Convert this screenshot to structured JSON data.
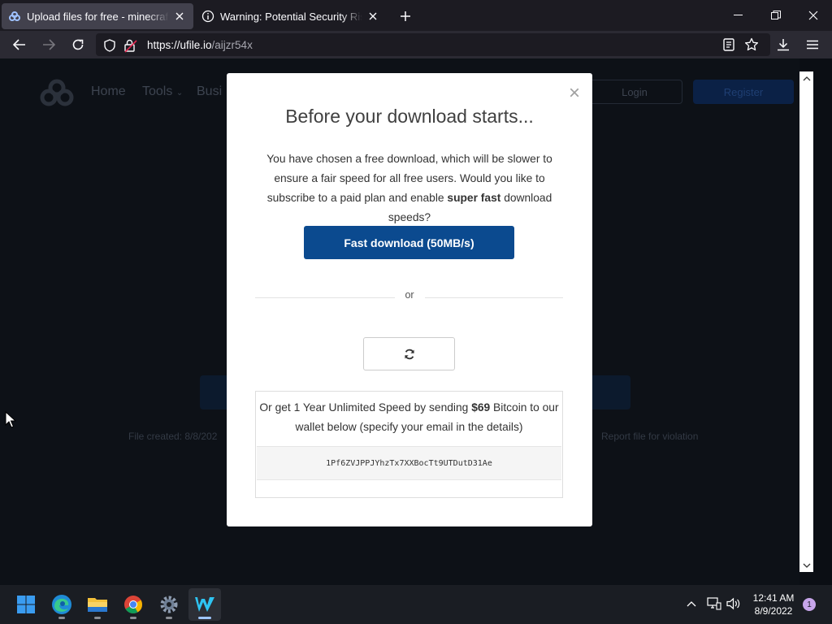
{
  "browser": {
    "tabs": [
      {
        "title": "Upload files for free - minecraft hy",
        "active": true,
        "favicon": "ufile-logo-icon"
      },
      {
        "title": "Warning: Potential Security Risk Ah",
        "active": false,
        "favicon": "info-circle-icon"
      }
    ],
    "address": {
      "host": "https://ufile.io",
      "path": "/aijzr54x"
    }
  },
  "background_page": {
    "nav": [
      "Home",
      "Tools",
      "Busi"
    ],
    "login_label": "Login",
    "register_label": "Register",
    "file_created": "File created: 8/8/202",
    "report_link": "Report file for violation"
  },
  "modal": {
    "title": "Before your download starts...",
    "text_before": "You have chosen a free download, which will be slower to ensure a fair speed for all free users. Would you like to subscribe to a paid plan and enable ",
    "text_bold": "super fast",
    "text_after": " download speeds?",
    "fast_button": "Fast download (50MB/s)",
    "or_label": "or",
    "bitcoin_before": "Or get 1 Year Unlimited Speed by sending ",
    "bitcoin_amount": "$69",
    "bitcoin_after": " Bitcoin to our wallet below (specify your email in the details)",
    "wallet": "1Pf6ZVJPPJYhzTx7XXBocTt9UTDutD31Ae"
  },
  "taskbar": {
    "apps": [
      "start-icon",
      "edge-icon",
      "file-explorer-icon",
      "chrome-icon",
      "settings-icon",
      "wondershare-icon"
    ],
    "time": "12:41 AM",
    "date": "8/9/2022",
    "notifications": "1"
  },
  "colors": {
    "accent_button": "#0b4a8f",
    "browser_bg": "#1c1b22",
    "toolbar_bg": "#2b2a33"
  }
}
